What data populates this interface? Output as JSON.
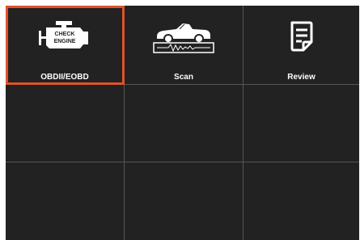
{
  "menu": {
    "tiles": [
      {
        "label": "OBDII/EOBD",
        "icon": "check-engine-icon",
        "icon_text_1": "CHECK",
        "icon_text_2": "ENGINE",
        "selected": true
      },
      {
        "label": "Scan",
        "icon": "car-scan-icon",
        "selected": false
      },
      {
        "label": "Review",
        "icon": "review-document-icon",
        "selected": false
      }
    ]
  },
  "colors": {
    "selection": "#e0522a",
    "background": "#1f1f1f",
    "grid_line": "#565656",
    "text": "#ffffff"
  }
}
